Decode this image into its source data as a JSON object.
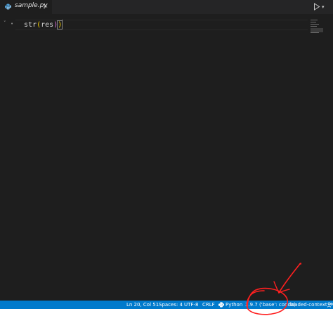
{
  "tab": {
    "filename": "sample.py",
    "close_glyph": "×",
    "file_icon": "python-file-icon"
  },
  "toolbar": {
    "run_icon": "play-icon",
    "run_dropdown_glyph": "▾"
  },
  "editor": {
    "fold_glyph": "˅",
    "bullet_glyph": "•",
    "code": {
      "indent": "  ",
      "fn": "str",
      "open_paren": "(",
      "arg": "res",
      "inner_close": ")",
      "outer_close": ")"
    }
  },
  "statusbar": {
    "cursor_position": "Ln 20, Col 51",
    "indentation": "Spaces: 4",
    "encoding": "UTF-8",
    "line_ending": "CRLF",
    "language": "Python",
    "interpreter": "3.9.7 ('base': conda)",
    "context": "loaded-context",
    "feedback_icon": "feedback-icon"
  },
  "colors": {
    "editor_bg": "#1e1e1e",
    "tabbar_bg": "#252526",
    "statusbar_bg": "#007acc",
    "annotation": "#ff2020",
    "paren_gold": "#ffd700",
    "paren_orchid": "#da70d6"
  }
}
